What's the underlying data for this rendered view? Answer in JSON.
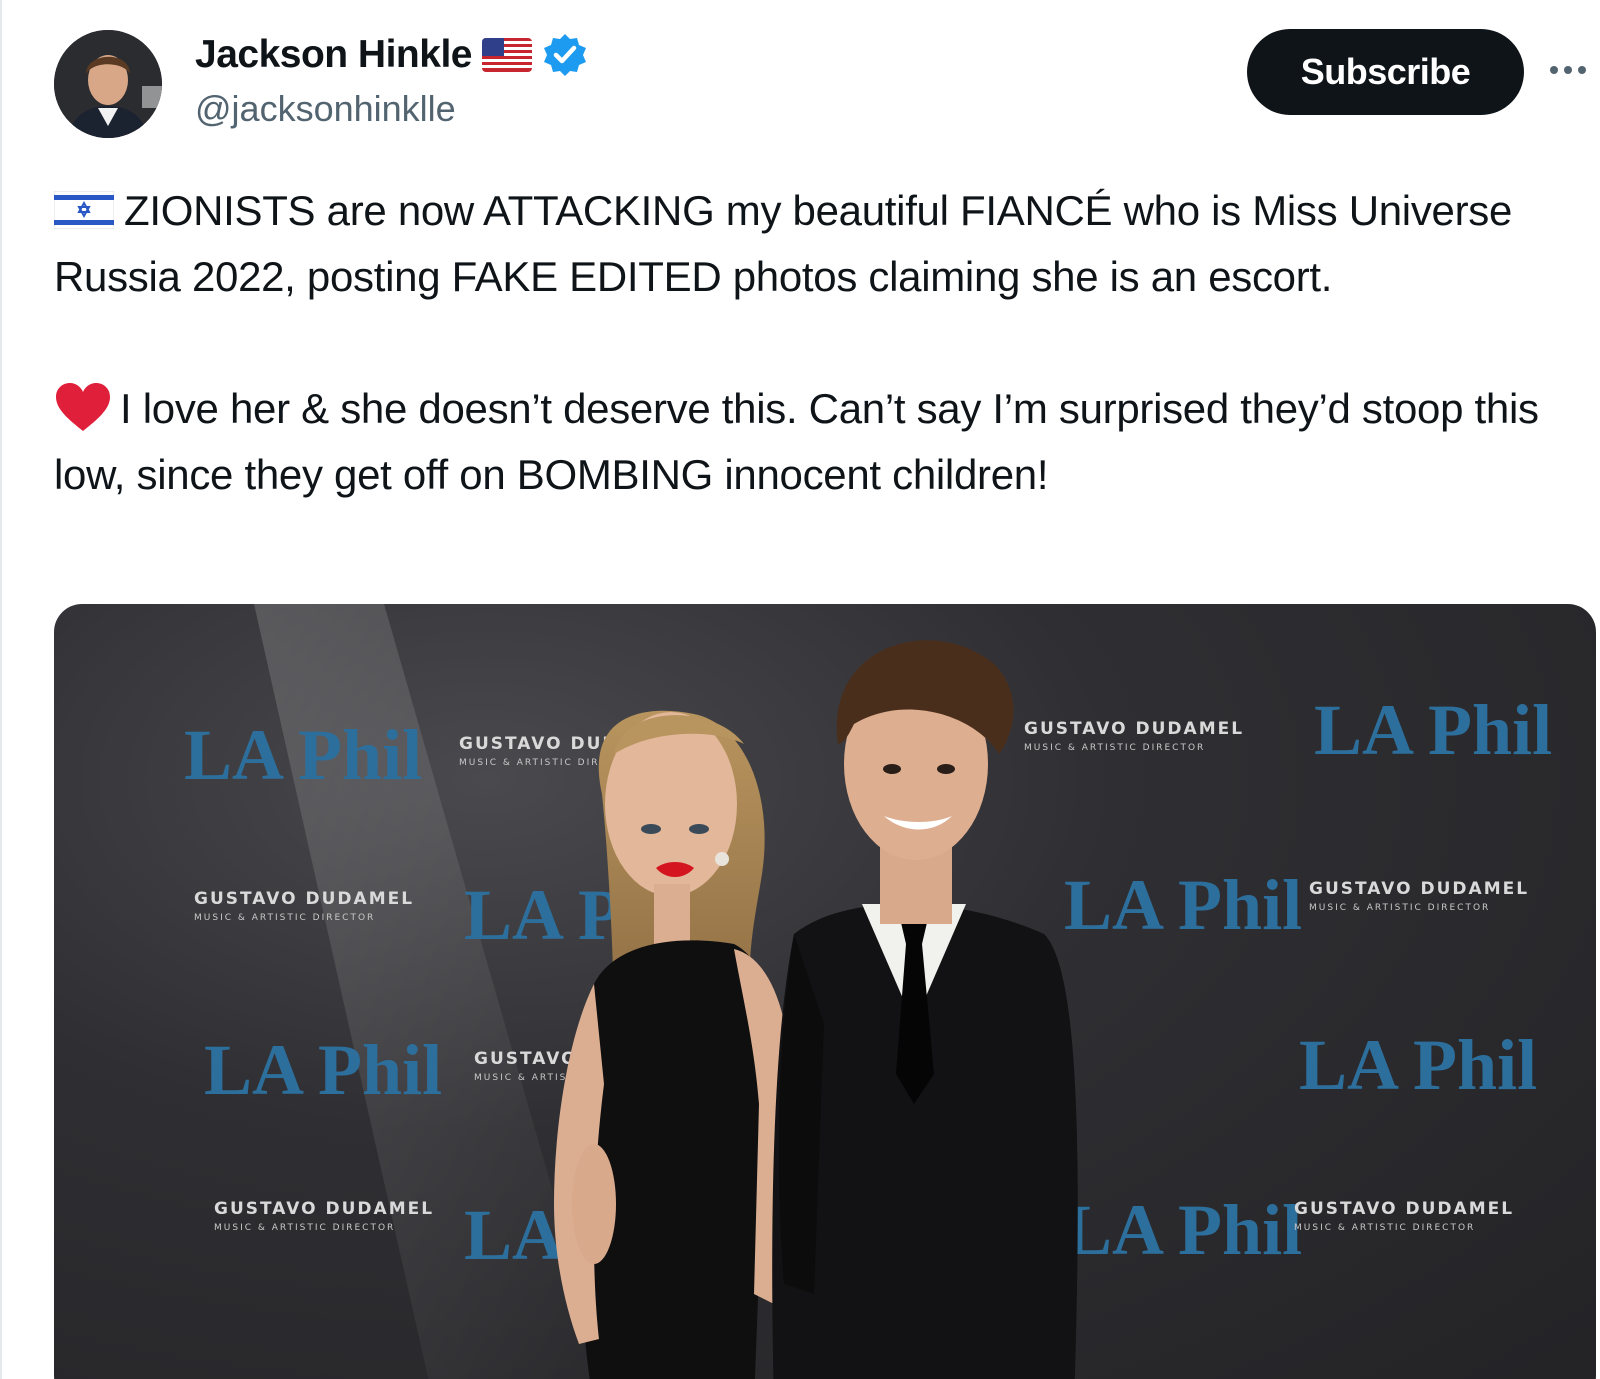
{
  "author": {
    "display_name": "Jackson Hinkle",
    "handle": "@jacksonhinklle",
    "flag_icon": "us-flag-icon",
    "verified_icon": "verified-badge-icon",
    "verified_color": "#1d9bf0"
  },
  "header": {
    "subscribe_label": "Subscribe",
    "more_icon": "more-horizontal-icon"
  },
  "tweet": {
    "paragraph_1": "ZIONISTS are now ATTACKING my beautiful FIANCÉ who is Miss Universe Russia 2022, posting FAKE EDITED photos claiming she is an escort.",
    "paragraph_1_icon": "israel-flag-icon",
    "paragraph_2": "I love her & she doesn’t deserve this. Can’t say I’m surprised they’d stoop this low, since they get off on BOMBING innocent children!",
    "paragraph_2_icon": "red-heart-icon"
  },
  "photo": {
    "backdrop_brand": "LA Phil",
    "backdrop_line_1": "GUSTAVO DUDAMEL",
    "backdrop_line_2": "MUSIC & ARTISTIC DIRECTOR",
    "brand_color": "#2d6f9c"
  }
}
